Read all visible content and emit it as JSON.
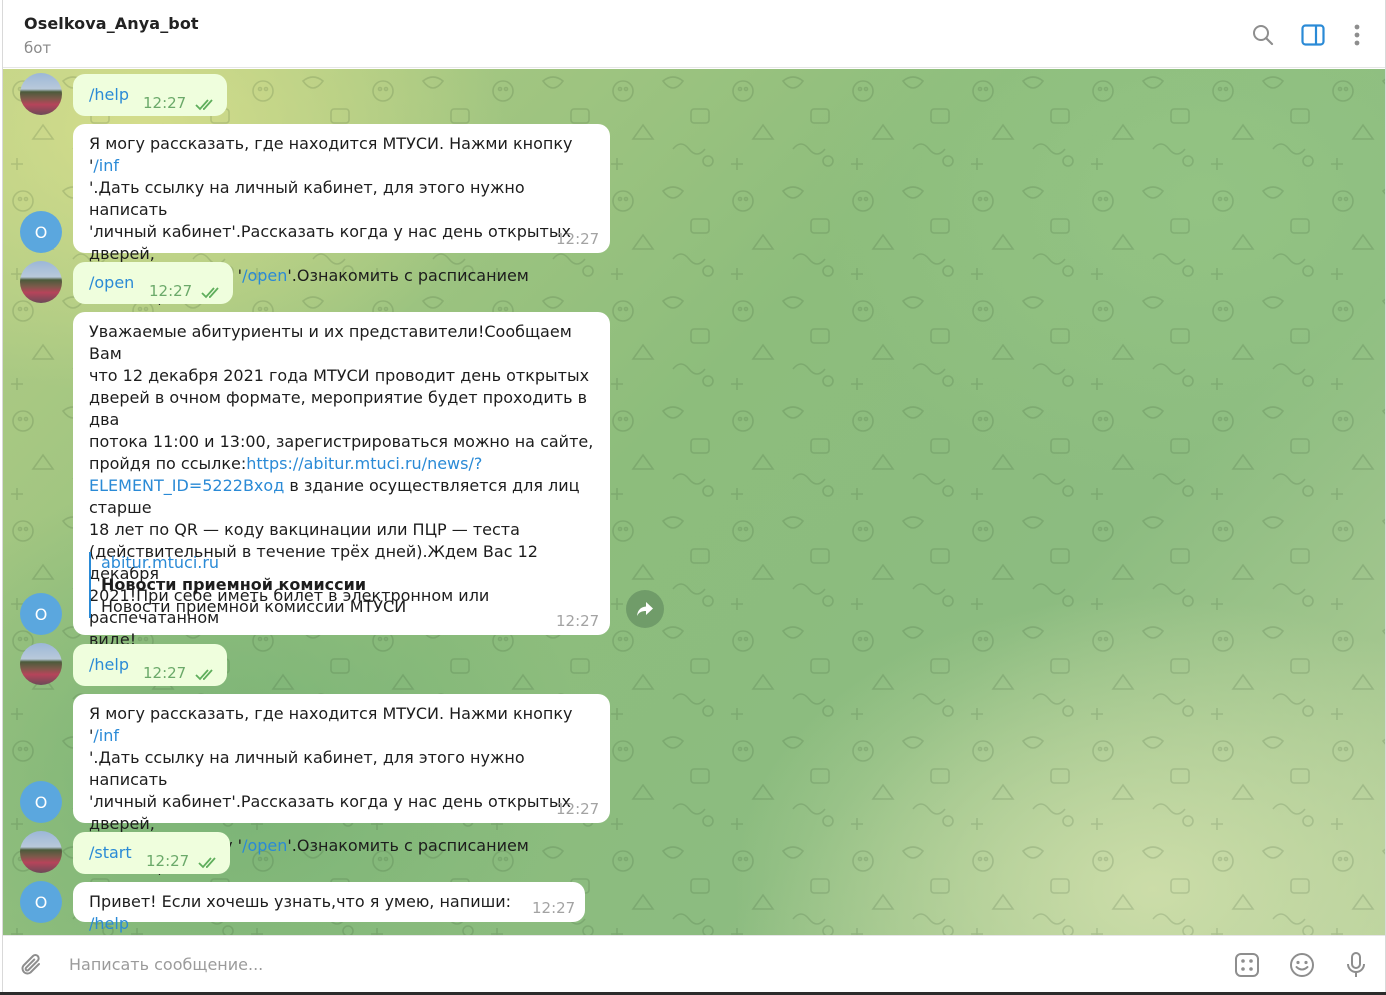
{
  "header": {
    "title": "Oselkova_Anya_bot",
    "subtitle": "бот",
    "icons": [
      "search-icon",
      "sidebar-toggle-icon",
      "more-vertical-icon"
    ],
    "accent": "#2a8ad6"
  },
  "bot_avatar_letter": "O",
  "messages": [
    {
      "dir": "out",
      "text": "/help",
      "time": "12:27",
      "status": "read"
    },
    {
      "dir": "in",
      "parts": [
        "Я могу рассказать, где находится МТУСИ. Нажми кнопку '",
        "/inf",
        "\n'.Дать ссылку на личный кабинет, для этого нужно написать\n'личный кабинет'.Рассказать когда у нас день открытых дверей,\nнапиши команду '",
        "/open",
        "'.Ознакомить с расписанием занятий,\nнапиши 'расписание'"
      ],
      "time": "12:27"
    },
    {
      "dir": "out",
      "text": "/open",
      "time": "12:27",
      "status": "read"
    },
    {
      "dir": "in",
      "parts": [
        "Уважаемые абитуриенты и их представители!Сообщаем Вам\nчто 12 декабря 2021 года МТУСИ проводит день открытых\nдверей в очном формате, мероприятие будет проходить в два\nпотока 11:00 и 13:00, зарегистрироваться можно на сайте,\nпройдя по ссылке:",
        "https://abitur.mtuci.ru/news/?\nELEMENT_ID=5222Вход",
        " в здание осуществляется для лиц старше\n18 лет по QR — коду вакцинации или ПЦР — теста\n(действительный в течение трёх дней).Ждем Вас 12 декабря\n2021!При себе иметь билет в электронном или распечатанном\nвиде!"
      ],
      "preview": {
        "site": "abitur.mtuci.ru",
        "title": "Новости приемной комиссии",
        "description": "Новости приемной комиссии МТУСИ"
      },
      "time": "12:27"
    },
    {
      "dir": "out",
      "text": "/help",
      "time": "12:27",
      "status": "read"
    },
    {
      "dir": "in",
      "parts": [
        "Я могу рассказать, где находится МТУСИ. Нажми кнопку '",
        "/inf",
        "\n'.Дать ссылку на личный кабинет, для этого нужно написать\n'личный кабинет'.Рассказать когда у нас день открытых дверей,\nнапиши команду '",
        "/open",
        "'.Ознакомить с расписанием занятий,\nнапиши 'расписание'"
      ],
      "time": "12:27"
    },
    {
      "dir": "out",
      "text": "/start",
      "time": "12:27",
      "status": "read"
    },
    {
      "dir": "in",
      "parts": [
        "Привет! Если хочешь узнать,что я умею, напиши: ",
        "/help"
      ],
      "time": "12:27"
    }
  ],
  "composer": {
    "placeholder": "Написать сообщение...",
    "icons": [
      "attach-icon",
      "bot-commands-icon",
      "emoji-icon",
      "microphone-icon"
    ]
  }
}
